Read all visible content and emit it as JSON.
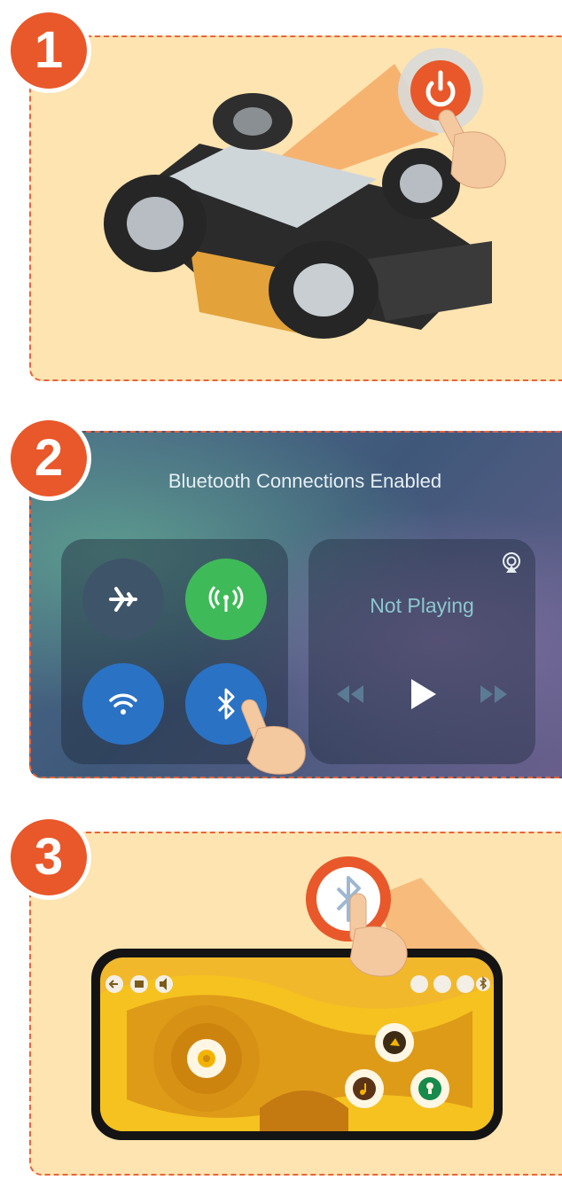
{
  "steps": {
    "step1": {
      "number": "1"
    },
    "step2": {
      "number": "2"
    },
    "step3": {
      "number": "3"
    }
  },
  "control_center": {
    "title": "Bluetooth Connections Enabled",
    "toggles": [
      {
        "icon": "airplane-icon",
        "state": "off"
      },
      {
        "icon": "cellular-icon",
        "state": "on"
      },
      {
        "icon": "wifi-icon",
        "state": "on"
      },
      {
        "icon": "bluetooth-icon",
        "state": "on"
      }
    ],
    "media": {
      "status": "Not Playing"
    }
  },
  "colors": {
    "accent": "#e8582a",
    "panel_bg": "#fde4b0",
    "toggle_green": "#3fba58",
    "toggle_blue": "#2a72c4"
  }
}
